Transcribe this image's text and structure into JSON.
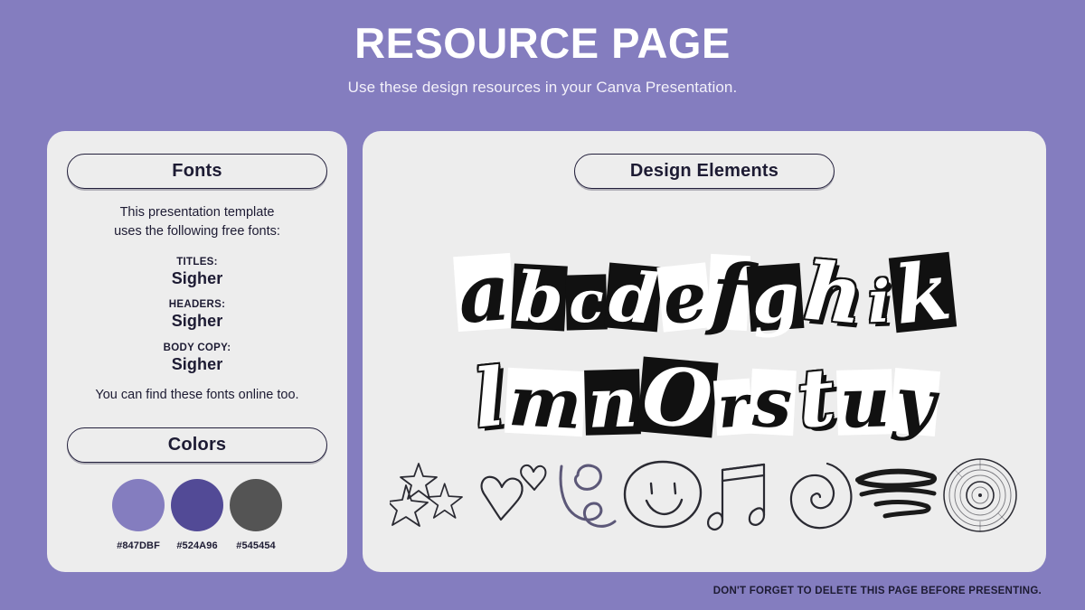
{
  "header": {
    "title": "RESOURCE PAGE",
    "subtitle": "Use these design resources in your Canva Presentation."
  },
  "fonts_panel": {
    "heading": "Fonts",
    "intro_line_1": "This presentation template",
    "intro_line_2": "uses the following free fonts:",
    "font_list": [
      {
        "role": "TITLES:",
        "name": "Sigher"
      },
      {
        "role": "HEADERS:",
        "name": "Sigher"
      },
      {
        "role": "BODY COPY:",
        "name": "Sigher"
      }
    ],
    "outro": "You can find these fonts online too."
  },
  "colors_panel": {
    "heading": "Colors",
    "swatches": [
      {
        "hex": "#847DBF",
        "label": "#847DBF"
      },
      {
        "hex": "#524A96",
        "label": "#524A96"
      },
      {
        "hex": "#545454",
        "label": "#545454"
      }
    ]
  },
  "elements_panel": {
    "heading": "Design Elements",
    "alphabet_row_1": [
      "a",
      "b",
      "c",
      "d",
      "e",
      "f",
      "g",
      "h",
      "i",
      "k"
    ],
    "alphabet_row_2": [
      "l",
      "m",
      "n",
      "O",
      "r",
      "s",
      "t",
      "u",
      "y"
    ],
    "doodles": [
      "stars-icon",
      "hearts-icon",
      "cursive-c-squiggle-icon",
      "smiley-face-icon",
      "music-note-icon",
      "spiral-icon",
      "scribble-lines-icon",
      "vinyl-record-icon"
    ]
  },
  "footer": {
    "note": "DON'T FORGET TO DELETE THIS PAGE BEFORE PRESENTING."
  },
  "theme": {
    "background": "#847DBF",
    "card_background": "#EDEDED",
    "ink": "#1D1B33",
    "doodle_ink": "#2A2A32",
    "doodle_purple": "#5C5878"
  }
}
